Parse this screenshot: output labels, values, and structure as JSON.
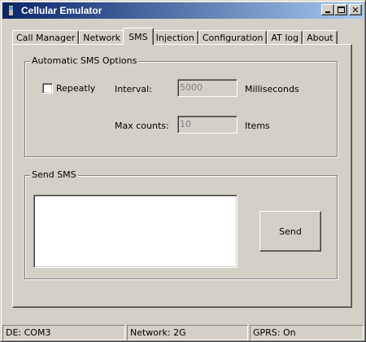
{
  "window": {
    "title": "Cellular Emulator",
    "controls": {
      "minimize": "minimize-icon",
      "maximize": "maximize-icon",
      "close": "close-icon"
    }
  },
  "tabs": [
    {
      "label": "Call Manager",
      "active": false
    },
    {
      "label": "Network",
      "active": false
    },
    {
      "label": "SMS",
      "active": true
    },
    {
      "label": "Injection",
      "active": false
    },
    {
      "label": "Configuration",
      "active": false
    },
    {
      "label": "AT log",
      "active": false
    },
    {
      "label": "About",
      "active": false
    }
  ],
  "auto_sms": {
    "group_title": "Automatic SMS Options",
    "repeatly_label": "Repeatly",
    "repeatly_checked": false,
    "interval_label": "Interval:",
    "interval_value": "5000",
    "interval_unit": "Milliseconds",
    "maxcount_label": "Max counts:",
    "maxcount_value": "10",
    "maxcount_unit": "Items"
  },
  "send_sms": {
    "group_title": "Send SMS",
    "message_value": "",
    "send_label": "Send"
  },
  "status": {
    "port": "DE: COM3",
    "network": "Network: 2G",
    "gprs": "GPRS: On"
  }
}
